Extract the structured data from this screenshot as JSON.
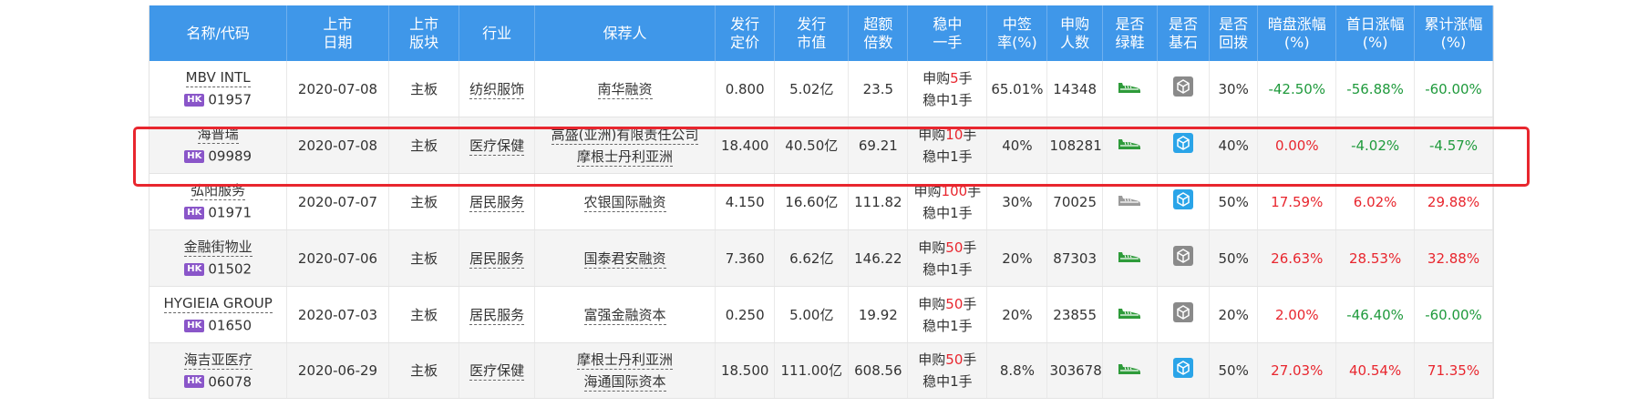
{
  "headers": [
    "名称/代码",
    "上市日期",
    "上市版块",
    "行业",
    "保荐人",
    "发行定价",
    "发行市值",
    "超额倍数",
    "稳中一手",
    "中签率(%)",
    "申购人数",
    "是否绿鞋",
    "是否基石",
    "是否回拨",
    "暗盘涨幅(%)",
    "首日涨幅(%)",
    "累计涨幅(%)"
  ],
  "header_lines": [
    [
      "名称/代码"
    ],
    [
      "上市",
      "日期"
    ],
    [
      "上市",
      "版块"
    ],
    [
      "行业"
    ],
    [
      "保荐人"
    ],
    [
      "发行",
      "定价"
    ],
    [
      "发行",
      "市值"
    ],
    [
      "超额",
      "倍数"
    ],
    [
      "稳中",
      "一手"
    ],
    [
      "中签",
      "率(%)"
    ],
    [
      "申购",
      "人数"
    ],
    [
      "是否",
      "绿鞋"
    ],
    [
      "是否",
      "基石"
    ],
    [
      "是否",
      "回拨"
    ],
    [
      "暗盘涨幅",
      "(%)"
    ],
    [
      "首日涨幅",
      "(%)"
    ],
    [
      "累计涨幅",
      "(%)"
    ]
  ],
  "badge_label": "HK",
  "rows": [
    {
      "name": "MBV INTL",
      "code": "01957",
      "date": "2020-07-08",
      "board": "主板",
      "industry": "纺织服饰",
      "sponsors": [
        "南华融资"
      ],
      "price": "0.800",
      "market_value": "5.02亿",
      "oversub": "23.5",
      "lot_prefix": "申购",
      "lot_num": "5",
      "lot_suffix": "手",
      "lot_line2": "稳中1手",
      "win_rate": "65.01%",
      "applicants": "14348",
      "greenshoe": "green",
      "cornerstone": "gray",
      "clawback": "30%",
      "dark": "-42.50%",
      "dark_color": "green",
      "first": "-56.88%",
      "first_color": "green",
      "cum": "-60.00%",
      "cum_color": "green"
    },
    {
      "name": "海普瑞",
      "code": "09989",
      "date": "2020-07-08",
      "board": "主板",
      "industry": "医疗保健",
      "sponsors": [
        "高盛(亚洲)有限责任公司",
        "摩根士丹利亚洲"
      ],
      "price": "18.400",
      "market_value": "40.50亿",
      "oversub": "69.21",
      "lot_prefix": "申购",
      "lot_num": "10",
      "lot_suffix": "手",
      "lot_line2": "稳中1手",
      "win_rate": "40%",
      "applicants": "108281",
      "greenshoe": "green",
      "cornerstone": "blue",
      "clawback": "40%",
      "dark": "0.00%",
      "dark_color": "red",
      "first": "-4.02%",
      "first_color": "green",
      "cum": "-4.57%",
      "cum_color": "green"
    },
    {
      "name": "弘阳服务",
      "code": "01971",
      "date": "2020-07-07",
      "board": "主板",
      "industry": "居民服务",
      "sponsors": [
        "农银国际融资"
      ],
      "price": "4.150",
      "market_value": "16.60亿",
      "oversub": "111.82",
      "lot_prefix": "申购",
      "lot_num": "100",
      "lot_suffix": "手",
      "lot_line2": "稳中1手",
      "win_rate": "30%",
      "applicants": "70025",
      "greenshoe": "gray",
      "cornerstone": "blue",
      "clawback": "50%",
      "dark": "17.59%",
      "dark_color": "red",
      "first": "6.02%",
      "first_color": "red",
      "cum": "29.88%",
      "cum_color": "red"
    },
    {
      "name": "金融街物业",
      "code": "01502",
      "date": "2020-07-06",
      "board": "主板",
      "industry": "居民服务",
      "sponsors": [
        "国泰君安融资"
      ],
      "price": "7.360",
      "market_value": "6.62亿",
      "oversub": "146.22",
      "lot_prefix": "申购",
      "lot_num": "50",
      "lot_suffix": "手",
      "lot_line2": "稳中1手",
      "win_rate": "20%",
      "applicants": "87303",
      "greenshoe": "green",
      "cornerstone": "gray",
      "clawback": "50%",
      "dark": "26.63%",
      "dark_color": "red",
      "first": "28.53%",
      "first_color": "red",
      "cum": "32.88%",
      "cum_color": "red"
    },
    {
      "name": "HYGIEIA GROUP",
      "code": "01650",
      "date": "2020-07-03",
      "board": "主板",
      "industry": "居民服务",
      "sponsors": [
        "富强金融资本"
      ],
      "price": "0.250",
      "market_value": "5.00亿",
      "oversub": "19.92",
      "lot_prefix": "申购",
      "lot_num": "50",
      "lot_suffix": "手",
      "lot_line2": "稳中1手",
      "win_rate": "20%",
      "applicants": "23855",
      "greenshoe": "green",
      "cornerstone": "gray",
      "clawback": "20%",
      "dark": "2.00%",
      "dark_color": "red",
      "first": "-46.40%",
      "first_color": "green",
      "cum": "-60.00%",
      "cum_color": "green"
    },
    {
      "name": "海吉亚医疗",
      "code": "06078",
      "date": "2020-06-29",
      "board": "主板",
      "industry": "医疗保健",
      "sponsors": [
        "摩根士丹利亚洲",
        "海通国际资本"
      ],
      "price": "18.500",
      "market_value": "111.00亿",
      "oversub": "608.56",
      "lot_prefix": "申购",
      "lot_num": "50",
      "lot_suffix": "手",
      "lot_line2": "稳中1手",
      "win_rate": "8.8%",
      "applicants": "303678",
      "greenshoe": "green",
      "cornerstone": "blue",
      "clawback": "50%",
      "dark": "27.03%",
      "dark_color": "red",
      "first": "40.54%",
      "first_color": "red",
      "cum": "71.35%",
      "cum_color": "red"
    }
  ],
  "colors": {
    "header_bg": "#3f97e9",
    "highlight": "#e8262e",
    "up": "#e8262e",
    "down": "#1f9a3c",
    "badge": "#8a56c9",
    "greenshoe_on": "#2e9b3a",
    "greenshoe_off": "#9a9a9a",
    "cornerstone_on": "#2aa4e8",
    "cornerstone_off": "#8a8a8a"
  },
  "icons": {
    "greenshoe": "shoe-icon",
    "cornerstone": "cube-icon"
  }
}
